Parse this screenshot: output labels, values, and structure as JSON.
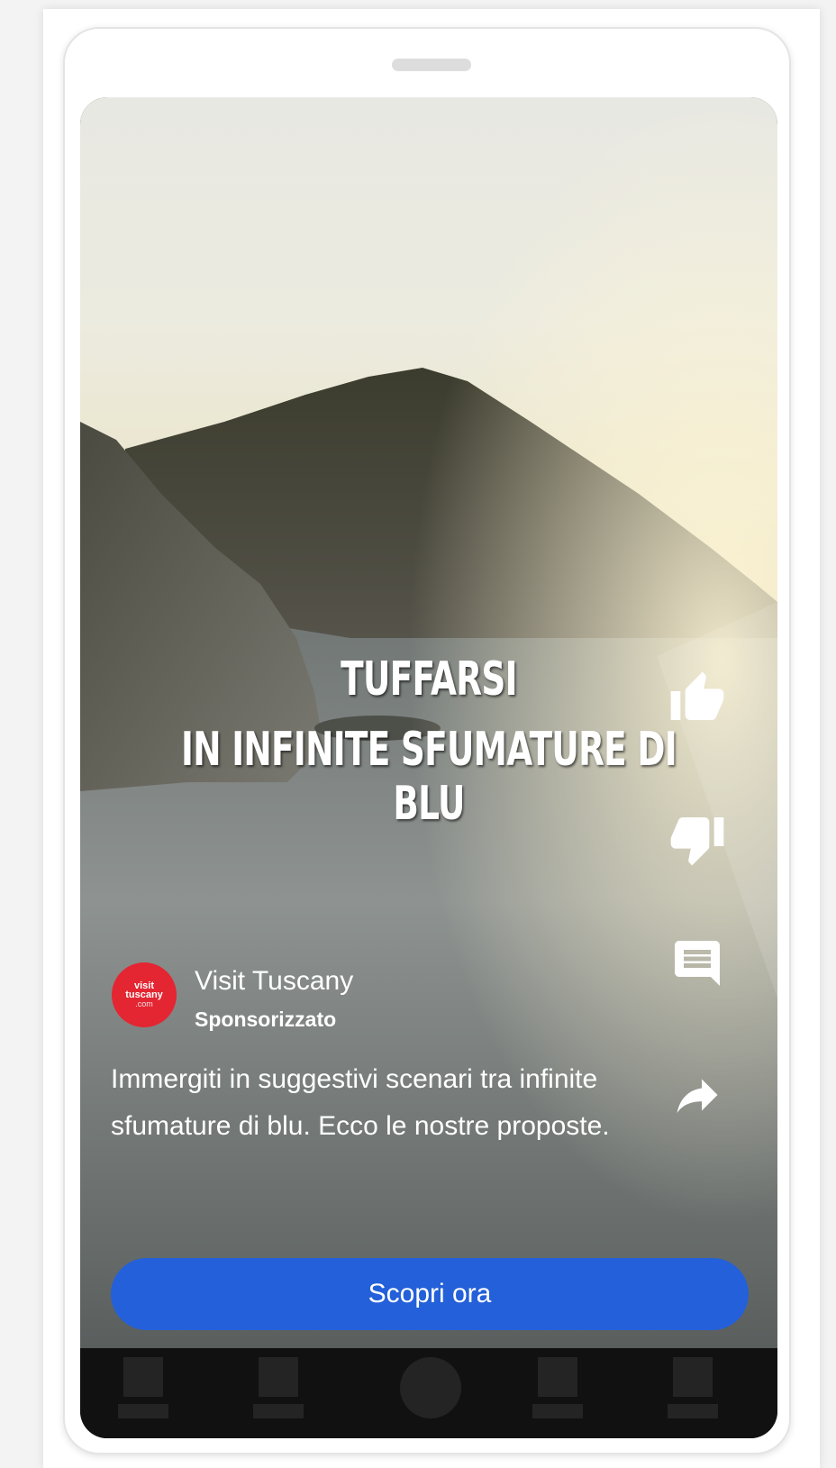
{
  "video": {
    "overlay_line1": "TUFFARSI",
    "overlay_line2": "IN INFINITE SFUMATURE DI BLU"
  },
  "actions": [
    {
      "icon": "thumb-up-icon"
    },
    {
      "icon": "thumb-down-icon"
    },
    {
      "icon": "comment-icon"
    },
    {
      "icon": "share-icon"
    }
  ],
  "advertiser": {
    "name": "Visit Tuscany",
    "label": "Sponsorizzato",
    "logo_text_1": "visit",
    "logo_text_2": "tuscany",
    "logo_text_3": ".com",
    "logo_color": "#e32632"
  },
  "ad": {
    "description": "Immergiti in suggestivi scenari tra infinite sfumature di blu. Ecco le nostre proposte.",
    "cta_label": "Scopri ora",
    "cta_color": "#2460d9"
  },
  "bottom_nav": {
    "items": [
      "nav-item-1",
      "nav-item-2",
      "nav-item-center",
      "nav-item-4",
      "nav-item-5"
    ]
  }
}
